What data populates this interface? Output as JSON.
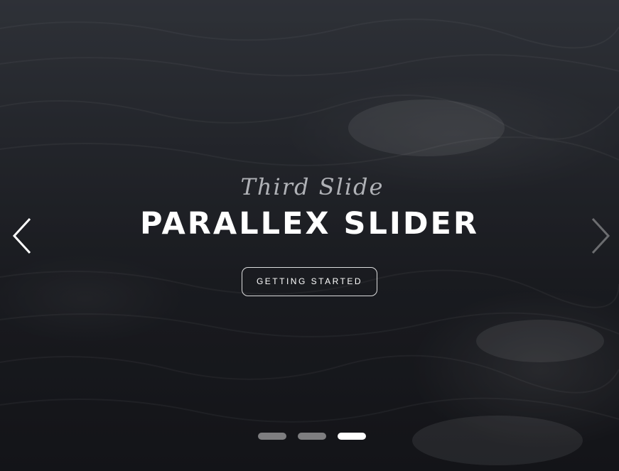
{
  "slide": {
    "subtitle": "Third Slide",
    "title": "PARALLEX SLIDER",
    "cta_label": "GETTING STARTED"
  },
  "navigation": {
    "prev_icon": "chevron-left-icon",
    "next_icon": "chevron-right-icon"
  },
  "pagination": {
    "total": 3,
    "active_index": 3
  },
  "colors": {
    "text": "#ffffff",
    "subtitle": "#c9cbcf",
    "dot_inactive": "rgba(255,255,255,0.45)",
    "dot_active": "#ffffff"
  }
}
